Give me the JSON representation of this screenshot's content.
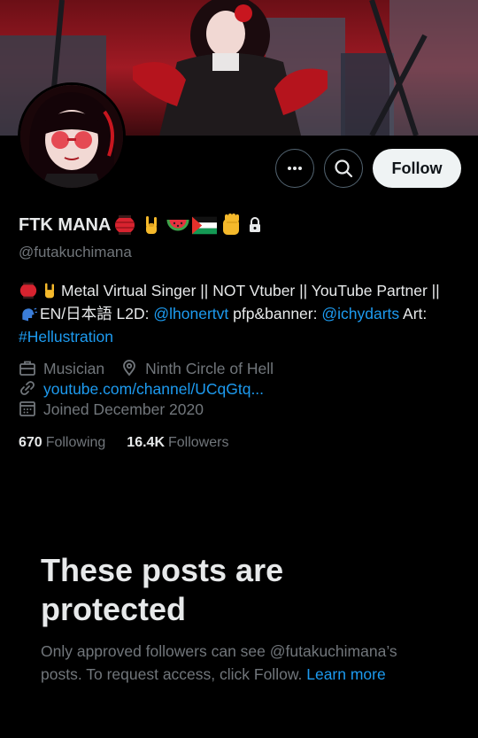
{
  "colors": {
    "background": "#000000",
    "accent": "#1d9bf0",
    "muted": "#71767b",
    "text": "#e7e9ea",
    "follow_bg": "#eff3f4"
  },
  "header": {
    "banner_icon": "banner-illustration",
    "avatar_icon": "profile-avatar"
  },
  "actions": {
    "more_icon": "more-icon",
    "search_icon": "search-icon",
    "follow_label": "Follow"
  },
  "profile": {
    "display_name": "FTK MANA",
    "handle": "@futakuchimana",
    "emojis": [
      "lantern-emoji",
      "rock-hand-emoji",
      "watermelon-emoji",
      "palestine-flag-emoji",
      "raised-fist-emoji"
    ],
    "protected_icon": "lock-icon"
  },
  "bio": {
    "line1_text": "Metal Virtual Singer || NOT Vtuber || YouTube Partner ||",
    "line2_prefix": "EN/日本語 L2D: ",
    "line2_link1": "@lhonertvt",
    "line2_mid": " pfp&banner: ",
    "line2_link2": "@ichydarts",
    "line2_suffix": " Art:",
    "line3_link": "#Hellustration"
  },
  "meta": {
    "profession": "Musician",
    "location": "Ninth Circle of Hell",
    "website": "youtube.com/channel/UCqGtq...",
    "joined": "Joined December 2020"
  },
  "stats": {
    "following_count": "670",
    "following_label": "Following",
    "followers_count": "16.4K",
    "followers_label": "Followers"
  },
  "protected_notice": {
    "title": "These posts are protected",
    "body": "Only approved followers can see @futakuchimana’s posts. To request access, click Follow.",
    "learn_more": "Learn more"
  }
}
